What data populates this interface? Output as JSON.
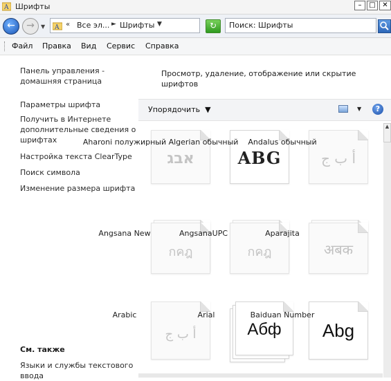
{
  "window": {
    "title": "Шрифты"
  },
  "address": {
    "breadcrumb": [
      "Все эл...",
      "Шрифты"
    ],
    "search_placeholder": "Поиск: Шрифты"
  },
  "menu": [
    "Файл",
    "Правка",
    "Вид",
    "Сервис",
    "Справка"
  ],
  "left_pane": {
    "links": [
      "Панель управления - домашняя страница",
      "Параметры шрифта",
      "Получить в Интернете дополнительные сведения о шрифтах",
      "Настройка текста ClearType",
      "Поиск символа",
      "Изменение размера шрифта"
    ],
    "see_also_title": "См. также",
    "see_also_links": [
      "Языки и службы текстового ввода"
    ]
  },
  "main": {
    "header": "Просмотр, удаление, отображение или скрытие шрифтов",
    "organize_label": "Упорядочить",
    "fonts": [
      {
        "name": "Aharoni полужирный",
        "sample": "אבג",
        "hidden": true,
        "stack": false
      },
      {
        "name": "Algerian обычный",
        "sample": "ABG",
        "hidden": false,
        "stack": false
      },
      {
        "name": "Andalus обычный",
        "sample": "أ ب ج",
        "hidden": true,
        "stack": false
      },
      {
        "name": "Angsana New",
        "sample": "กคฎ",
        "hidden": true,
        "stack": true
      },
      {
        "name": "AngsanaUPC",
        "sample": "กคฎ",
        "hidden": true,
        "stack": true
      },
      {
        "name": "Aparajita",
        "sample": "अबक",
        "hidden": true,
        "stack": true
      },
      {
        "name": "Arabic",
        "sample": "أ ب ج",
        "hidden": true,
        "stack": false
      },
      {
        "name": "Arial",
        "sample": "Абф",
        "hidden": false,
        "stack": true
      },
      {
        "name": "Baiduan Number",
        "sample": "Abg",
        "hidden": false,
        "stack": false
      }
    ]
  },
  "icons": {
    "back": "back-arrow-icon",
    "forward": "forward-arrow-icon",
    "refresh": "refresh-icon",
    "search": "magnifier-icon",
    "help": "help-icon",
    "view": "change-view-icon"
  },
  "colors": {
    "link": "#2b2b2b",
    "accent": "#1a55b5"
  }
}
